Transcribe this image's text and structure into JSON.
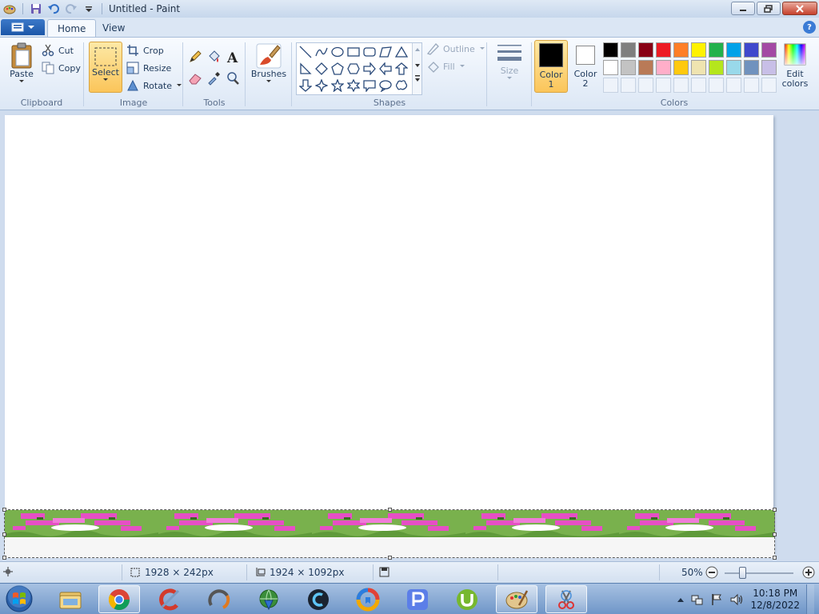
{
  "window": {
    "title": "Untitled - Paint"
  },
  "tabs": [
    {
      "label": "Home"
    },
    {
      "label": "View"
    }
  ],
  "help_label": "?",
  "clipboard": {
    "paste": "Paste",
    "cut": "Cut",
    "copy": "Copy",
    "group": "Clipboard"
  },
  "image": {
    "select": "Select",
    "crop": "Crop",
    "resize": "Resize",
    "rotate": "Rotate",
    "group": "Image"
  },
  "tools": {
    "group": "Tools"
  },
  "brushes": {
    "label": "Brushes"
  },
  "shapes": {
    "outline": "Outline",
    "fill": "Fill",
    "group": "Shapes"
  },
  "size": {
    "label": "Size"
  },
  "colors": {
    "color1_line1": "Color",
    "color1_line2": "1",
    "color2_line1": "Color",
    "color2_line2": "2",
    "edit_line1": "Edit",
    "edit_line2": "colors",
    "group": "Colors",
    "color1_value": "#000000",
    "color2_value": "#ffffff",
    "palette_row1": [
      "#000000",
      "#7f7f7f",
      "#880015",
      "#ed1c24",
      "#ff7f27",
      "#fff200",
      "#22b14c",
      "#00a2e8",
      "#3f48cc",
      "#a349a4"
    ],
    "palette_row2": [
      "#ffffff",
      "#c3c3c3",
      "#b97a57",
      "#ffaec9",
      "#ffc90e",
      "#efe4b0",
      "#b5e61d",
      "#99d9ea",
      "#7092be",
      "#c8bfe7"
    ]
  },
  "status": {
    "selection_size": "1928 × 242px",
    "image_size": "1924 × 1092px",
    "zoom": "50%"
  },
  "clock": {
    "time": "10:18 PM",
    "date": "12/8/2022"
  }
}
